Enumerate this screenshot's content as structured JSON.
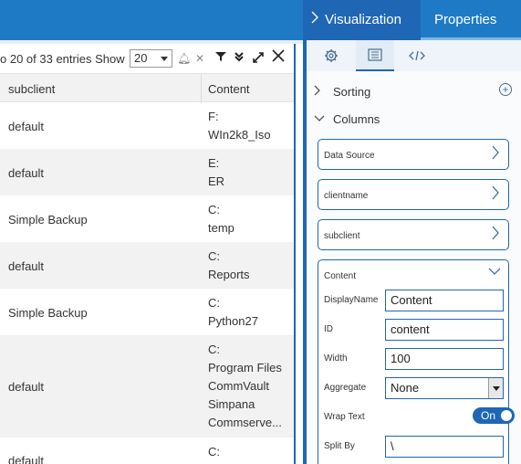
{
  "table": {
    "entries_text": "o 20 of 33 entries Show",
    "page_size": "20",
    "columns": [
      "subclient",
      "Content"
    ],
    "rows": [
      {
        "subclient": "default",
        "content": [
          "F:",
          "WIn2k8_Iso"
        ]
      },
      {
        "subclient": "default",
        "content": [
          "E:",
          "ER"
        ]
      },
      {
        "subclient": "Simple Backup",
        "content": [
          "C:",
          "temp"
        ]
      },
      {
        "subclient": "default",
        "content": [
          "C:",
          "Reports"
        ]
      },
      {
        "subclient": "Simple Backup",
        "content": [
          "C:",
          "Python27"
        ]
      },
      {
        "subclient": "default",
        "content": [
          "C:",
          "Program Files",
          "CommVault",
          "Simpana",
          "Commserve..."
        ]
      },
      {
        "subclient": "default",
        "content": [
          "C:"
        ]
      }
    ],
    "toolbar_icons": [
      "bell-icon",
      "clear-filter-icon",
      "filter-icon",
      "double-chevron-down-icon",
      "expand-icon",
      "close-icon"
    ]
  },
  "panel": {
    "tabs": {
      "visualization": "Visualization",
      "properties": "Properties"
    },
    "icon_tabs": [
      "gear-icon",
      "list-icon",
      "code-icon"
    ],
    "sections": {
      "sorting": "Sorting",
      "columns": "Columns"
    },
    "column_cards": [
      "Data Source",
      "clientname",
      "subclient"
    ],
    "expanded": {
      "title": "Content",
      "display_name_label": "DisplayName",
      "display_name_value": "Content",
      "id_label": "ID",
      "id_value": "content",
      "width_label": "Width",
      "width_value": "100",
      "aggregate_label": "Aggregate",
      "aggregate_value": "None",
      "wrap_text_label": "Wrap Text",
      "wrap_text_state": "On",
      "split_by_label": "Split By",
      "split_by_value": "\\"
    }
  },
  "colors": {
    "accent": "#1f66b5",
    "header": "#1f7ac6",
    "row_alt": "#f2f2f2"
  }
}
